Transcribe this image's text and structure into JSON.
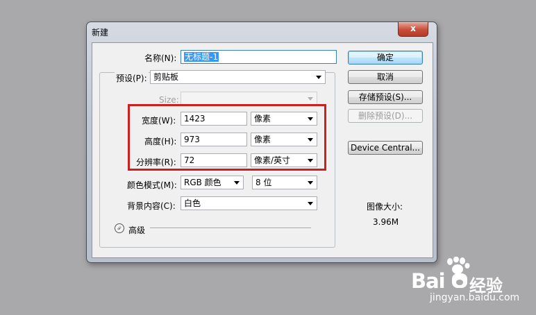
{
  "dialog": {
    "title": "新建",
    "close_label": "x"
  },
  "form": {
    "name_label": "名称(N):",
    "name_value": "无标题-1",
    "preset_label": "预设(P):",
    "preset_value": "剪贴板",
    "size_label": "Size:",
    "size_value": "",
    "width_label": "宽度(W):",
    "width_value": "1423",
    "width_unit": "像素",
    "height_label": "高度(H):",
    "height_value": "973",
    "height_unit": "像素",
    "resolution_label": "分辨率(R):",
    "resolution_value": "72",
    "resolution_unit": "像素/英寸",
    "color_mode_label": "颜色模式(M):",
    "color_mode_value": "RGB 颜色",
    "bit_depth_value": "8 位",
    "background_label": "背景内容(C):",
    "background_value": "白色",
    "advanced_label": "高级"
  },
  "buttons": {
    "ok": "确定",
    "cancel": "取消",
    "save_preset": "存储预设(S)...",
    "delete_preset": "删除预设(D)...",
    "device_central": "Device Central..."
  },
  "image_size": {
    "label": "图像大小:",
    "value": "3.96M"
  },
  "watermark": {
    "brand": "Bai",
    "brand_suffix": "经验",
    "url": "jingyan.baidu.com"
  },
  "colors": {
    "highlight_box": "#cc1f1f",
    "selection": "#3399ff"
  }
}
